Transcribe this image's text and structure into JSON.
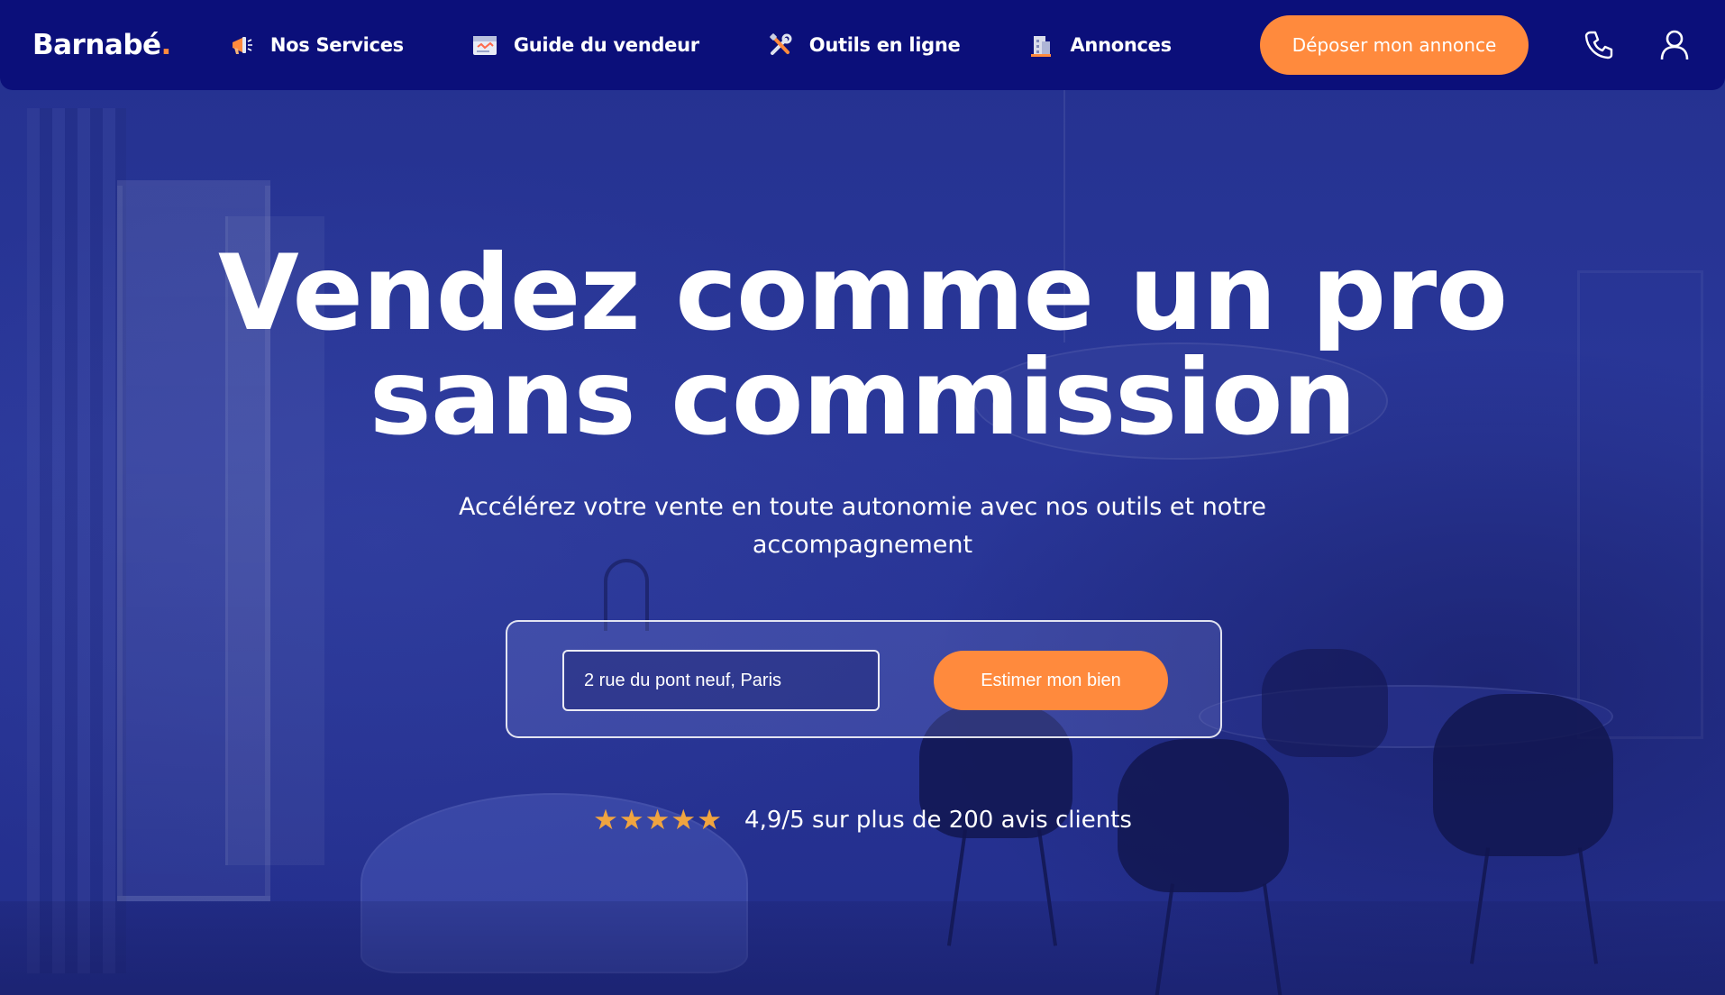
{
  "brand": {
    "name": "Barnabé",
    "dot": ".",
    "accent": "#ff8a3d",
    "navy": "#0b0f7a"
  },
  "nav": {
    "items": [
      {
        "label": "Nos Services",
        "icon": "megaphone-icon"
      },
      {
        "label": "Guide du vendeur",
        "icon": "calendar-guide-icon"
      },
      {
        "label": "Outils en ligne",
        "icon": "tools-icon"
      },
      {
        "label": "Annonces",
        "icon": "building-icon"
      }
    ],
    "cta_label": "Déposer mon annonce",
    "phone_icon": "phone-icon",
    "account_icon": "user-icon"
  },
  "hero": {
    "headline_line1": "Vendez comme un pro",
    "headline_line2": "sans commission",
    "subheadline_line1": "Accélérez votre vente en toute autonomie avec nos outils et notre",
    "subheadline_line2": "accompagnement",
    "search": {
      "value": "2 rue du pont neuf, Paris",
      "button_label": "Estimer mon bien"
    },
    "rating": {
      "stars": "★★★★★",
      "text": "4,9/5 sur plus de 200 avis clients",
      "star_color": "#f0a440"
    }
  }
}
